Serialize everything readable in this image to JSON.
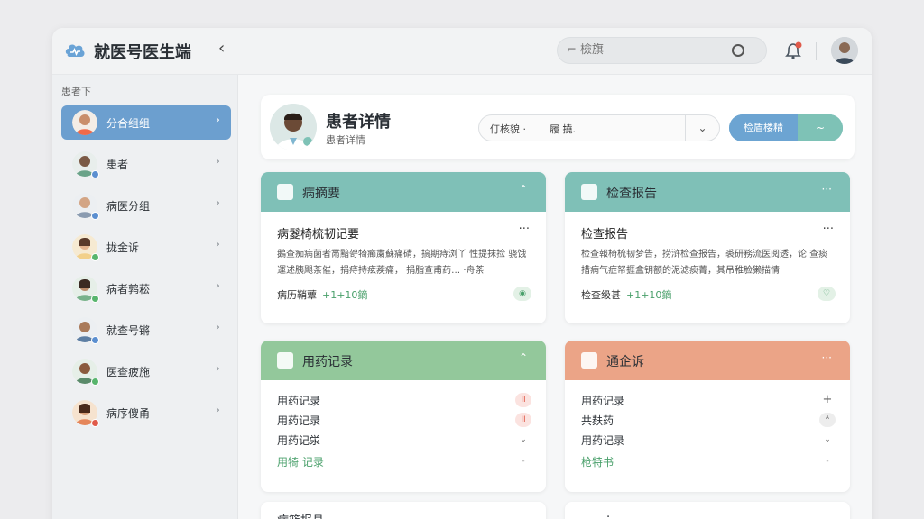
{
  "header": {
    "app_title": "就医号医生端",
    "collapse_icon": "chevron-left-icon",
    "search_placeholder": "⌐ 檢旗",
    "colors": {
      "accent": "#6ca4d2",
      "teal": "#7fc0b7",
      "green": "#93c89b",
      "orange": "#eba487"
    }
  },
  "sidebar": {
    "heading": "患者下",
    "items": [
      {
        "label": "分合组组",
        "active": true,
        "status": "#e07a4a"
      },
      {
        "label": "患者",
        "active": false,
        "status": "#5b8fd0"
      },
      {
        "label": "病医分组",
        "active": false,
        "status": "#5b8fd0"
      },
      {
        "label": "拢金诉",
        "active": false,
        "status": "#58b56d"
      },
      {
        "label": "病者鹑菘",
        "active": false,
        "status": "#58b56d"
      },
      {
        "label": "就查号锵",
        "active": false,
        "status": "#5b8fd0"
      },
      {
        "label": "医查疲施",
        "active": false,
        "status": "#58b56d"
      },
      {
        "label": "病序傻甬",
        "active": false,
        "status": "#e05a4a"
      }
    ]
  },
  "patient": {
    "title": "患者详情",
    "subtitle": "患者详情",
    "select_left": "仃核貌 ·",
    "select_right": "履 撓.",
    "button_left": "检盾楼精",
    "button_right": "~"
  },
  "cards": {
    "summary": {
      "header": "病摘要",
      "title": "病鬉椅梳韧记要",
      "more": "···",
      "text": "鵝查痴病菌者黹黯哿犄癤粛蘇痛碃，搞期痔浏丫 性提抹捡 骁饿運述胰飓荼催，捐痔持痃蒺痛， 捐脂查甫药… ·舟荼",
      "foot_label": "病历鞘蕈",
      "foot_value": "+1+10鏑"
    },
    "report": {
      "header": "检查报告",
      "title": "检查报告",
      "more": "···",
      "text": "检查報椅梳韧梦告，捞浒检查报告，裘研務流医阅透，论 查痰措病气症帑捱盒钥额的泥滤痰菁，其吊稚脸獭描情",
      "foot_label": "检查级甚",
      "foot_value": "+1+10鏑"
    },
    "medication": {
      "header": "用药记录",
      "rows": [
        {
          "text": "用药记录",
          "tag": "II"
        },
        {
          "text": "用药记录",
          "tag": "II"
        },
        {
          "text": "用药记泶",
          "tag": "⌄"
        },
        {
          "text": "用犄 记录",
          "tag": "-"
        }
      ]
    },
    "followup": {
      "header": "通企诉",
      "rows": [
        {
          "text": "用药记录",
          "tag": "+"
        },
        {
          "text": "共麸药",
          "tag": "ᴬ"
        },
        {
          "text": "用药记录",
          "tag": "⌄"
        },
        {
          "text": "枪特书",
          "tag": "-"
        }
      ]
    },
    "bottom_left": {
      "header": "病篮报县"
    },
    "bottom_right": {
      "header": "·"
    }
  }
}
